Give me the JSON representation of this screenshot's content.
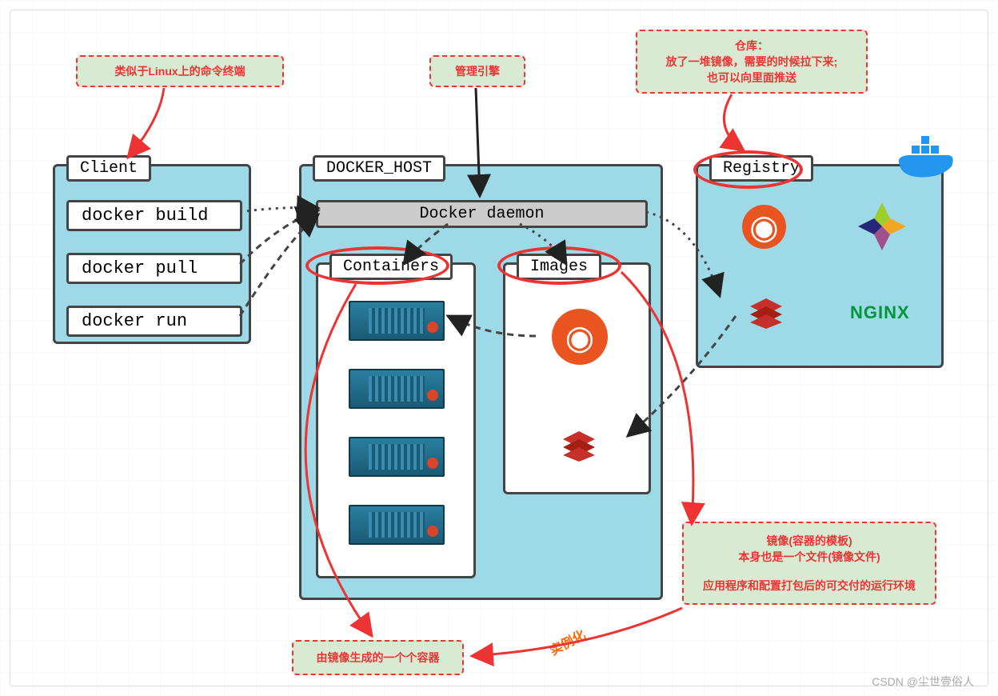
{
  "annotations": {
    "client_note": "类似于Linux上的命令终端",
    "daemon_note": "管理引擎",
    "registry_note_l1": "仓库：",
    "registry_note_l2": "放了一堆镜像，需要的时候拉下来;",
    "registry_note_l3": "也可以向里面推送",
    "containers_note": "由镜像生成的一个个容器",
    "images_note_l1": "镜像(容器的模板)",
    "images_note_l2": "本身也是一个文件(镜像文件)",
    "images_note_l3": "应用程序和配置打包后的可交付的运行环境",
    "instantiate": "实例化"
  },
  "panels": {
    "client": "Client",
    "docker_host": "DOCKER_HOST",
    "registry": "Registry"
  },
  "commands": {
    "build": "docker build",
    "pull": "docker pull",
    "run": "docker run"
  },
  "daemon": "Docker daemon",
  "sections": {
    "containers": "Containers",
    "images": "Images"
  },
  "logos": {
    "ubuntu": "ubuntu",
    "centos": "centos",
    "redis": "redis",
    "nginx": "NGINX",
    "docker_whale": "docker"
  },
  "watermark": "CSDN @尘世壹俗人"
}
